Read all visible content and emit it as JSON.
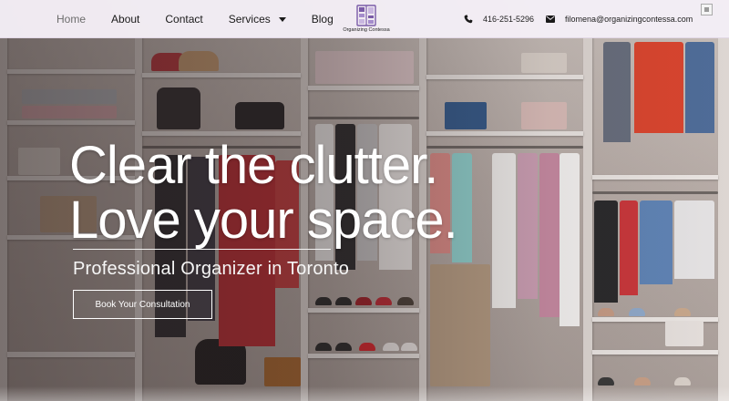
{
  "nav": {
    "items": [
      {
        "label": "Home",
        "active": true
      },
      {
        "label": "About"
      },
      {
        "label": "Contact"
      },
      {
        "label": "Services",
        "has_dropdown": true
      },
      {
        "label": "Blog"
      }
    ]
  },
  "logo": {
    "name": "Organizing Contessa",
    "icon": "closet-icon",
    "color": "#7b5ca8"
  },
  "contact": {
    "phone": "416-251-5296",
    "phone_icon": "phone-icon",
    "email": "filomena@organizingcontessa.com",
    "email_icon": "mail-icon"
  },
  "hero": {
    "headline_line1": "Clear the clutter.",
    "headline_line2": "Love your space.",
    "subheadline": "Professional Organizer in Toronto",
    "cta_label": "Book Your Consultation",
    "background": "closet-photo"
  },
  "colors": {
    "header_bg": "#f4eef6",
    "text_dark": "#1a1a1a",
    "hero_text": "#ffffff",
    "brand": "#7b5ca8"
  }
}
